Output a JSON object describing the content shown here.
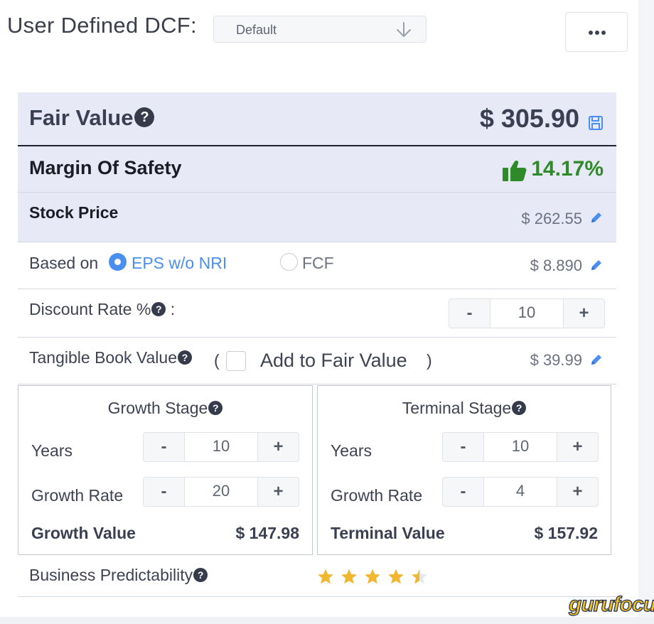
{
  "header": {
    "title": "User Defined DCF:",
    "preset_value": "Default"
  },
  "fair_value": {
    "label": "Fair Value",
    "amount": "$ 305.90"
  },
  "margin_of_safety": {
    "label": "Margin Of Safety",
    "value": "14.17%",
    "color": "#2f8a2a"
  },
  "stock_price": {
    "label": "Stock Price",
    "value": "$ 262.55"
  },
  "based_on": {
    "label": "Based on",
    "options": [
      {
        "label": "EPS w/o NRI",
        "selected": true
      },
      {
        "label": "FCF",
        "selected": false
      }
    ],
    "value": "$ 8.890"
  },
  "discount_rate": {
    "label": "Discount Rate %",
    "suffix": ":",
    "value": "10"
  },
  "tangible_book": {
    "label": "Tangible Book Value",
    "open_paren": "(",
    "checkbox_label": "Add to Fair Value",
    "close_paren": ")",
    "value": "$ 39.99"
  },
  "growth_stage": {
    "title": "Growth Stage",
    "years_label": "Years",
    "years": "10",
    "rate_label": "Growth Rate",
    "rate": "20",
    "value_label": "Growth Value",
    "value": "$ 147.98"
  },
  "terminal_stage": {
    "title": "Terminal Stage",
    "years_label": "Years",
    "years": "10",
    "rate_label": "Growth Rate",
    "rate": "4",
    "value_label": "Terminal Value",
    "value": "$ 157.92"
  },
  "predictability": {
    "label": "Business Predictability",
    "rating": 4.5,
    "max": 5
  },
  "stepper": {
    "minus": "-",
    "plus": "+"
  },
  "help_glyph": "?",
  "brand": "gurufocus",
  "colors": {
    "accent": "#4a8ff0",
    "panel": "#e7eaf6",
    "star": "#f0b72f"
  },
  "icons": [
    "chevron-down-icon",
    "more-icon",
    "help-icon",
    "save-icon",
    "thumbs-up-icon",
    "pencil-icon",
    "star-icon"
  ]
}
